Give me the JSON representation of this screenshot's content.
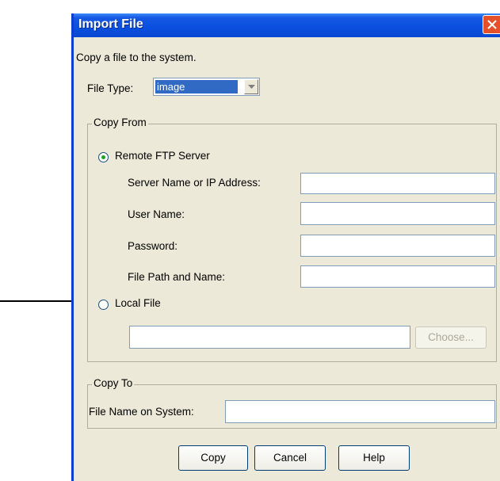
{
  "dialog": {
    "title": "Import File",
    "description": "Copy a file to the system.",
    "file_type_label": "File Type:",
    "file_type_value": "image"
  },
  "copy_from": {
    "legend": "Copy From",
    "remote_label": "Remote FTP Server",
    "remote_selected": true,
    "server_label": "Server Name or IP Address:",
    "user_label": "User Name:",
    "password_label": "Password:",
    "path_label": "File Path and Name:",
    "local_label": "Local File",
    "local_selected": false,
    "choose_label": "Choose..."
  },
  "copy_to": {
    "legend": "Copy To",
    "file_name_label": "File Name on System:"
  },
  "buttons": {
    "copy": "Copy",
    "cancel": "Cancel",
    "help": "Help"
  },
  "colors": {
    "titlebar": "#0a4fdf",
    "dialog_bg": "#ece9d8",
    "close": "#e3502a",
    "selection": "#316ac5"
  }
}
